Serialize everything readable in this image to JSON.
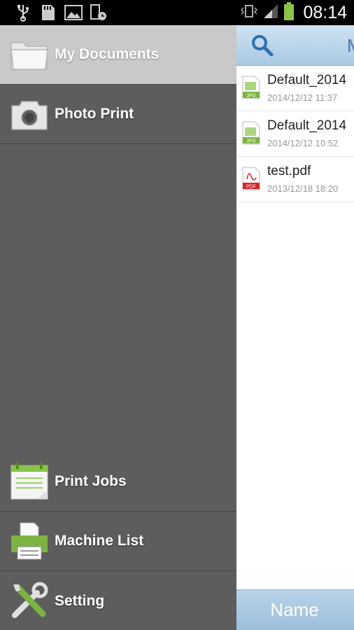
{
  "status_bar": {
    "time": "08:14",
    "icons": [
      "usb-icon",
      "sd-card-icon",
      "image-icon",
      "phone-clock-icon",
      "vibrate-icon",
      "signal-icon",
      "battery-icon"
    ]
  },
  "drawer": {
    "items": [
      {
        "label": "My Documents",
        "icon": "folder-icon",
        "active": true
      },
      {
        "label": "Photo Print",
        "icon": "camera-icon",
        "active": false
      },
      {
        "label": "Print Jobs",
        "icon": "print-jobs-icon",
        "active": false
      },
      {
        "label": "Machine List",
        "icon": "printer-icon",
        "active": false
      },
      {
        "label": "Setting",
        "icon": "tools-icon",
        "active": false
      }
    ]
  },
  "content": {
    "title_partial": "M",
    "files": [
      {
        "name": "Default_2014",
        "date": "2014/12/12 11:37",
        "type": "JPG"
      },
      {
        "name": "Default_2014",
        "date": "2014/12/12 10:52",
        "type": "JPG"
      },
      {
        "name": "test.pdf",
        "date": "2013/12/18 18:20",
        "type": "PDF"
      }
    ],
    "sort_label": "Name"
  },
  "colors": {
    "drawer_bg": "#5d5d5d",
    "drawer_active": "#c9c9c9",
    "header_blue": "#a8c9e3",
    "pdf_red": "#d9242b",
    "jpg_green": "#7cb342"
  }
}
